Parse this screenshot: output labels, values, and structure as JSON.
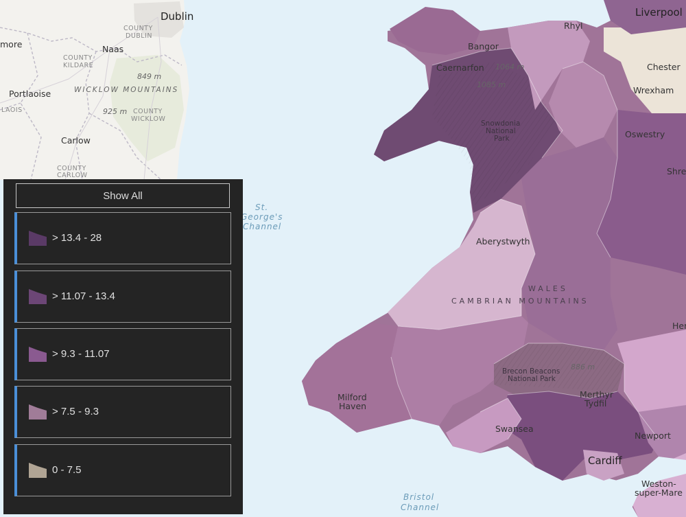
{
  "legend": {
    "show_all": "Show All",
    "items": [
      {
        "label": "> 13.4 - 28",
        "color": "#5a3a66"
      },
      {
        "label": "> 11.07 - 13.4",
        "color": "#6c4676"
      },
      {
        "label": "> 9.3 - 11.07",
        "color": "#8a5a90"
      },
      {
        "label": "> 7.5 - 9.3",
        "color": "#a07c98"
      },
      {
        "label": "0 - 7.5",
        "color": "#b0a494"
      }
    ]
  },
  "map_labels": {
    "dublin": "Dublin",
    "county_dublin": [
      "COUNTY",
      "DUBLIN"
    ],
    "naas": "Naas",
    "more": "more",
    "county_kildare": [
      "COUNTY",
      "KILDARE"
    ],
    "elev_849": "849 m",
    "wicklow_mountains": "WICKLOW MOUNTAINS",
    "portlaoise": "Portlaoise",
    "laois": "LAOIS",
    "elev_925": "925 m",
    "county_wicklow": [
      "COUNTY",
      "WICKLOW"
    ],
    "carlow": "Carlow",
    "county_carlow": [
      "COUNTY",
      "CARLOW"
    ],
    "st_georges_channel": [
      "St.",
      "George's",
      "Channel"
    ],
    "rhyl": "Rhyl",
    "liverpool": "Liverpool",
    "bangor": "Bangor",
    "caernarfon": "Caernarfon",
    "elev_1064": "1064 m",
    "elev_1085": "1085 m",
    "chester": "Chester",
    "wrexham": "Wrexham",
    "snowdonia": [
      "Snowdonia",
      "National",
      "Park"
    ],
    "oswestry": "Oswestry",
    "shre": "Shre",
    "aberystwyth": "Aberystwyth",
    "wales": "WALES",
    "cambrian_mountains": "CAMBRIAN MOUNTAINS",
    "her": "Her",
    "brecon_beacons": [
      "Brecon Beacons",
      "National Park"
    ],
    "elev_886": "886 m",
    "milford_haven": [
      "Milford",
      "Haven"
    ],
    "merthyr_tydfil": [
      "Merthyr",
      "Tydfil"
    ],
    "swansea": "Swansea",
    "newport": "Newport",
    "cardiff": "Cardiff",
    "weston": [
      "Weston-",
      "super-Mare"
    ],
    "bristol_channel": [
      "Bristol",
      "Channel"
    ]
  }
}
